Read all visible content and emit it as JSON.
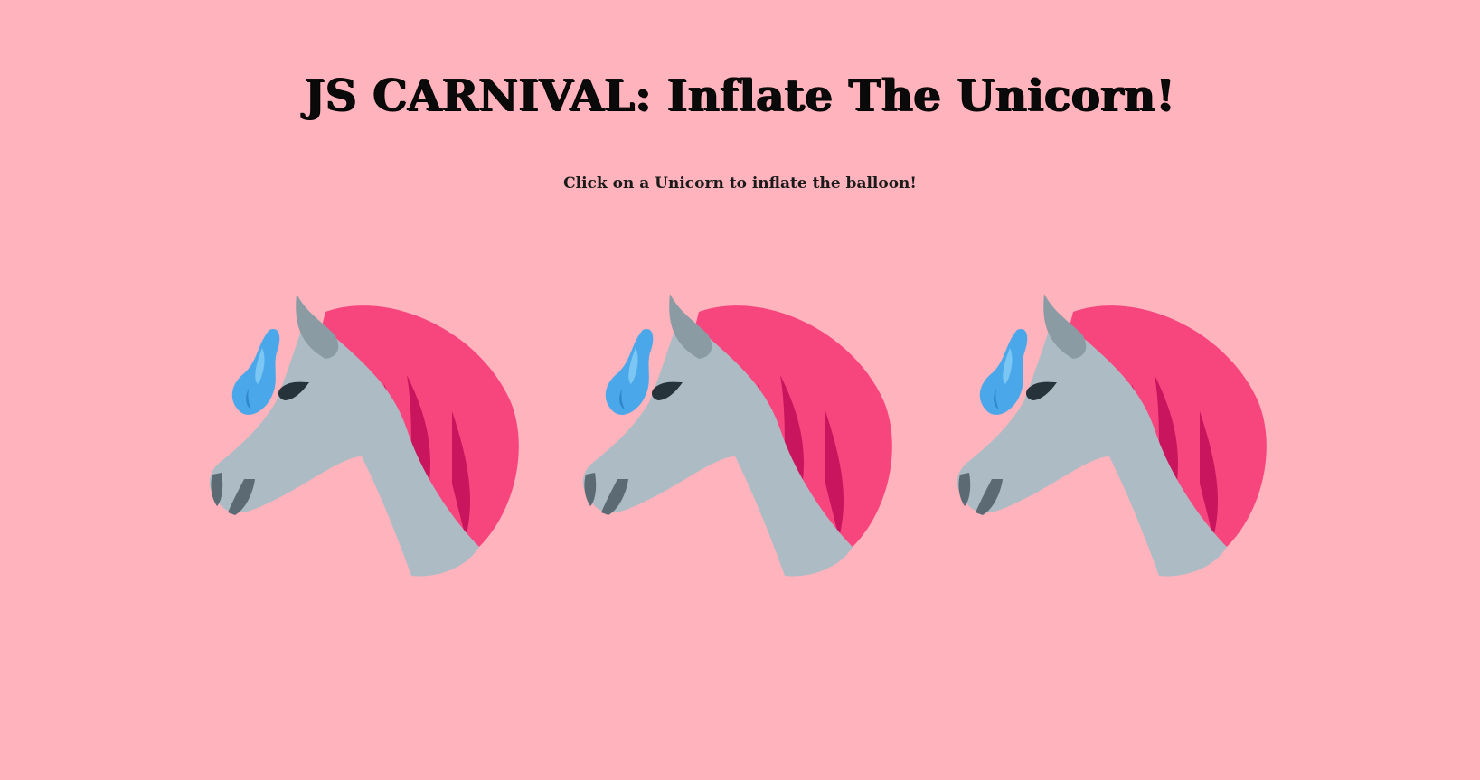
{
  "page": {
    "title": "JS CARNIVAL: Inflate The Unicorn!",
    "instruction": "Click on a Unicorn to inflate the balloon!"
  },
  "colors": {
    "background": "#ffb3bc",
    "mane": "#f7457e",
    "mane_dark": "#c9155d",
    "head": "#adbcc4",
    "horn": "#8a9ba3",
    "nose": "#5c6b73",
    "eye": "#27333a",
    "balloon": "#4aa8ea"
  },
  "unicorns": [
    {
      "icon": "unicorn-icon",
      "balloon_icon": "balloon-icon"
    },
    {
      "icon": "unicorn-icon",
      "balloon_icon": "balloon-icon"
    },
    {
      "icon": "unicorn-icon",
      "balloon_icon": "balloon-icon"
    }
  ]
}
